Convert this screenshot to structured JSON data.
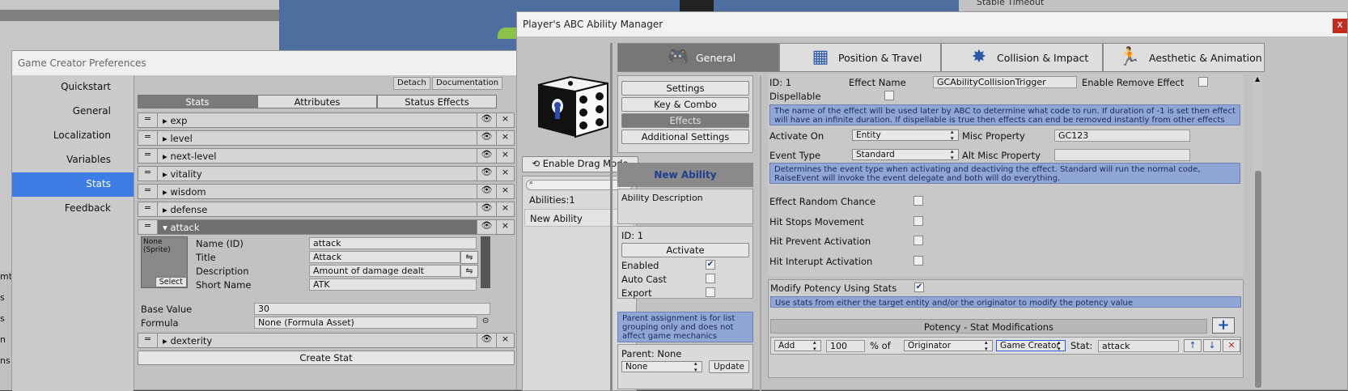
{
  "bg": {
    "right_text": "Stable Timeout",
    "left_strip": [
      "mt",
      "s",
      "s",
      "n",
      "ns"
    ]
  },
  "gc": {
    "title": "Game Creator Preferences",
    "sidebar": [
      "Quickstart",
      "General",
      "Localization",
      "Variables",
      "Stats",
      "Feedback"
    ],
    "active": "Stats",
    "detach": "Detach",
    "documentation": "Documentation",
    "tabs": [
      "Stats",
      "Attributes",
      "Status Effects"
    ],
    "stats": [
      "exp",
      "level",
      "next-level",
      "vitality",
      "wisdom",
      "defense"
    ],
    "open_stat": "attack",
    "after_stat": "dexterity",
    "sprite_label": "None (Sprite)",
    "select": "Select",
    "name_label": "Name (ID)",
    "name_value": "attack",
    "title_label": "Title",
    "title_value": "Attack",
    "desc_label": "Description",
    "desc_value": "Amount of damage dealt",
    "short_label": "Short Name",
    "short_value": "ATK",
    "base_label": "Base Value",
    "base_value": "30",
    "formula_label": "Formula",
    "formula_value": "None (Formula Asset)",
    "create": "Create Stat"
  },
  "abc": {
    "title": "Player's ABC Ability Manager",
    "close": "x",
    "drag": "Enable Drag Mode",
    "abilities_count": "Abilities:1",
    "ability_name": "New Ability",
    "tabs": [
      "General",
      "Position & Travel",
      "Collision & Impact",
      "Aesthetic & Animation"
    ],
    "tab_icons": [
      "gamepad-icon",
      "board-icon",
      "impact-icon",
      "animation-icon"
    ],
    "nav": [
      "Settings",
      "Key & Combo",
      "Effects",
      "Additional Settings"
    ],
    "nav_active": "Effects",
    "ability_header": "New Ability",
    "ability_desc": "Ability Description",
    "id": "ID: 1",
    "activate": "Activate",
    "enabled": "Enabled",
    "autocast": "Auto Cast",
    "export": "Export",
    "parent_note": "Parent assignment is for list grouping only and does not affect game mechanics",
    "parent": "Parent: None",
    "parent_dd": "None",
    "update": "Update",
    "effect": {
      "id": "ID: 1",
      "name_label": "Effect Name",
      "name_value": "GCAbilityCollisionTrigger",
      "enable_remove": "Enable Remove Effect",
      "dispellable": "Dispellable",
      "info1": "The name of the effect will be used later by ABC to determine what code to run. If duration of -1 is set then effect will have an infinite duration. If dispellable is true then effects can end be removed instantly from other effects",
      "activate_on": "Activate On",
      "activate_on_value": "Entity",
      "misc": "Misc Property",
      "misc_value": "GC123",
      "event_type": "Event Type",
      "event_type_value": "Standard",
      "alt_misc": "Alt Misc Property",
      "info2": "Determines the event type when activating and deactiving the effect. Standard will run the normal code, RaiseEvent will invoke the event delegate and both will do everything.",
      "random": "Effect Random Chance",
      "hit_stop": "Hit Stops Movement",
      "hit_prevent": "Hit Prevent Activation",
      "hit_interupt": "Hit Interupt Activation",
      "modify": "Modify Potency Using Stats",
      "info3": "Use stats from either the target entity and/or the originator to modify the potency value",
      "potency_header": "Potency - Stat Modifications",
      "mod_op": "Add",
      "mod_value": "100",
      "pct_of": "% of",
      "mod_source": "Originator",
      "mod_system": "Game Creator",
      "stat_label": "Stat:",
      "stat_value": "attack"
    }
  }
}
